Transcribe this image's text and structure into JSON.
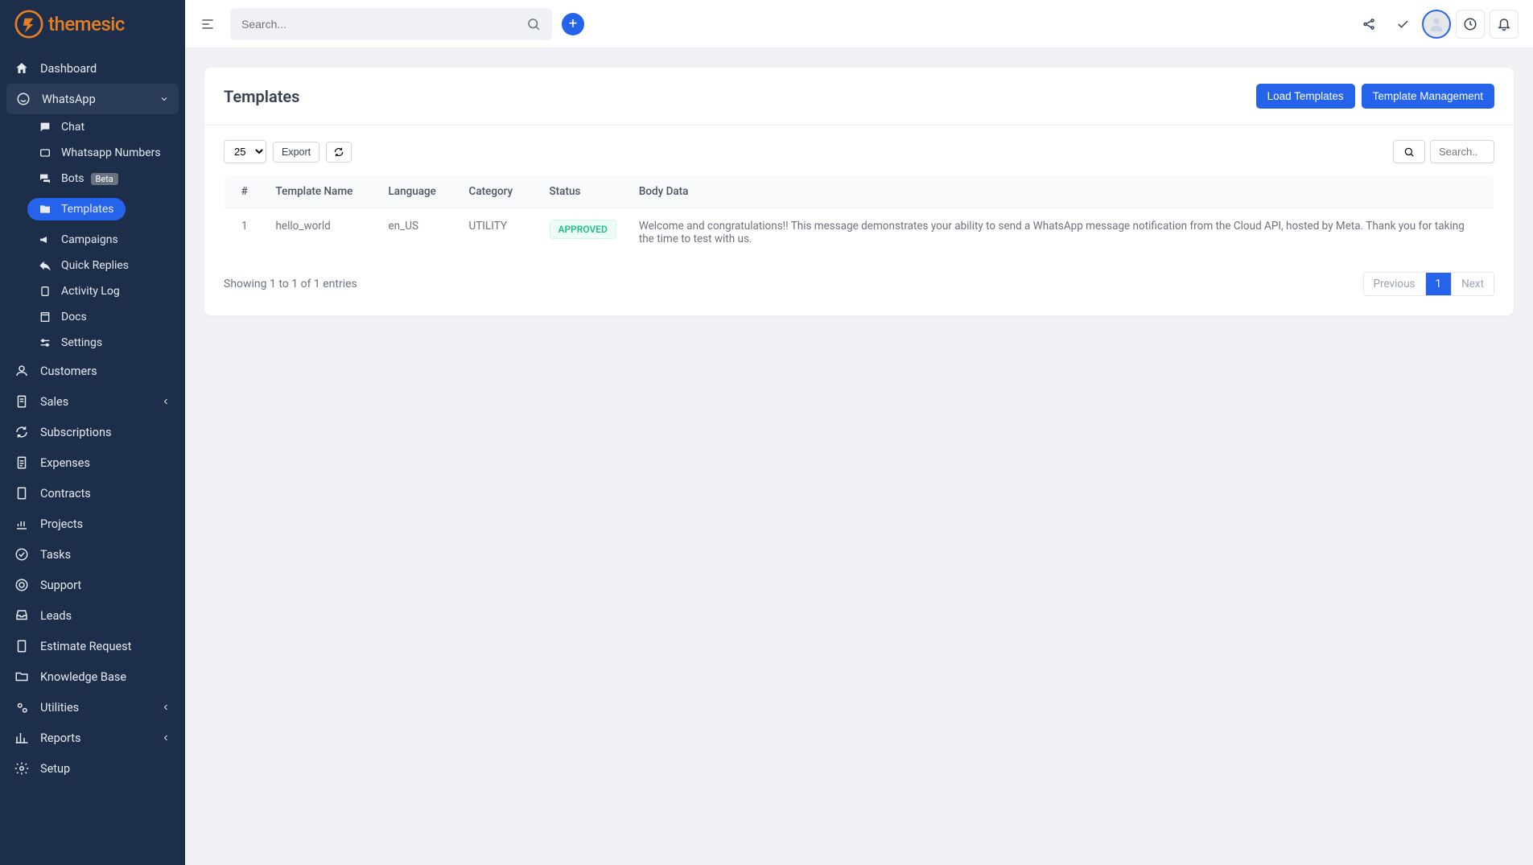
{
  "brand": {
    "name": "themesic"
  },
  "topbar": {
    "search_placeholder": "Search...",
    "add_label": "+"
  },
  "sidebar": {
    "items": [
      {
        "label": "Dashboard",
        "icon": "home"
      },
      {
        "label": "WhatsApp",
        "icon": "whatsapp",
        "expanded": true,
        "children": [
          {
            "label": "Chat",
            "icon": "chat"
          },
          {
            "label": "Whatsapp Numbers",
            "icon": "card"
          },
          {
            "label": "Bots",
            "icon": "comments",
            "badge": "Beta"
          },
          {
            "label": "Templates",
            "icon": "folder",
            "active": true
          },
          {
            "label": "Campaigns",
            "icon": "bullhorn"
          },
          {
            "label": "Quick Replies",
            "icon": "reply"
          },
          {
            "label": "Activity Log",
            "icon": "clipboard"
          },
          {
            "label": "Docs",
            "icon": "book"
          },
          {
            "label": "Settings",
            "icon": "sliders"
          }
        ]
      },
      {
        "label": "Customers",
        "icon": "user"
      },
      {
        "label": "Sales",
        "icon": "file",
        "chev": true
      },
      {
        "label": "Subscriptions",
        "icon": "refresh"
      },
      {
        "label": "Expenses",
        "icon": "file-lines"
      },
      {
        "label": "Contracts",
        "icon": "file-blank"
      },
      {
        "label": "Projects",
        "icon": "chart"
      },
      {
        "label": "Tasks",
        "icon": "check-circle"
      },
      {
        "label": "Support",
        "icon": "life-ring"
      },
      {
        "label": "Leads",
        "icon": "inbox"
      },
      {
        "label": "Estimate Request",
        "icon": "file-doc"
      },
      {
        "label": "Knowledge Base",
        "icon": "folder-open"
      },
      {
        "label": "Utilities",
        "icon": "gears",
        "chev": true
      },
      {
        "label": "Reports",
        "icon": "bar-chart",
        "chev": true
      },
      {
        "label": "Setup",
        "icon": "gear"
      }
    ]
  },
  "page": {
    "title": "Templates",
    "load_templates_label": "Load Templates",
    "template_mgmt_label": "Template Management",
    "page_size": "25",
    "export_label": "Export",
    "search_placeholder": "Search..",
    "columns": [
      "#",
      "Template Name",
      "Language",
      "Category",
      "Status",
      "Body Data"
    ],
    "rows": [
      {
        "num": "1",
        "name": "hello_world",
        "lang": "en_US",
        "category": "UTILITY",
        "status": "APPROVED",
        "body": "Welcome and congratulations!! This message demonstrates your ability to send a WhatsApp message notification from the Cloud API, hosted by Meta. Thank you for taking the time to test with us."
      }
    ],
    "showing_text": "Showing 1 to 1 of 1 entries",
    "prev_label": "Previous",
    "page_num": "1",
    "next_label": "Next"
  }
}
